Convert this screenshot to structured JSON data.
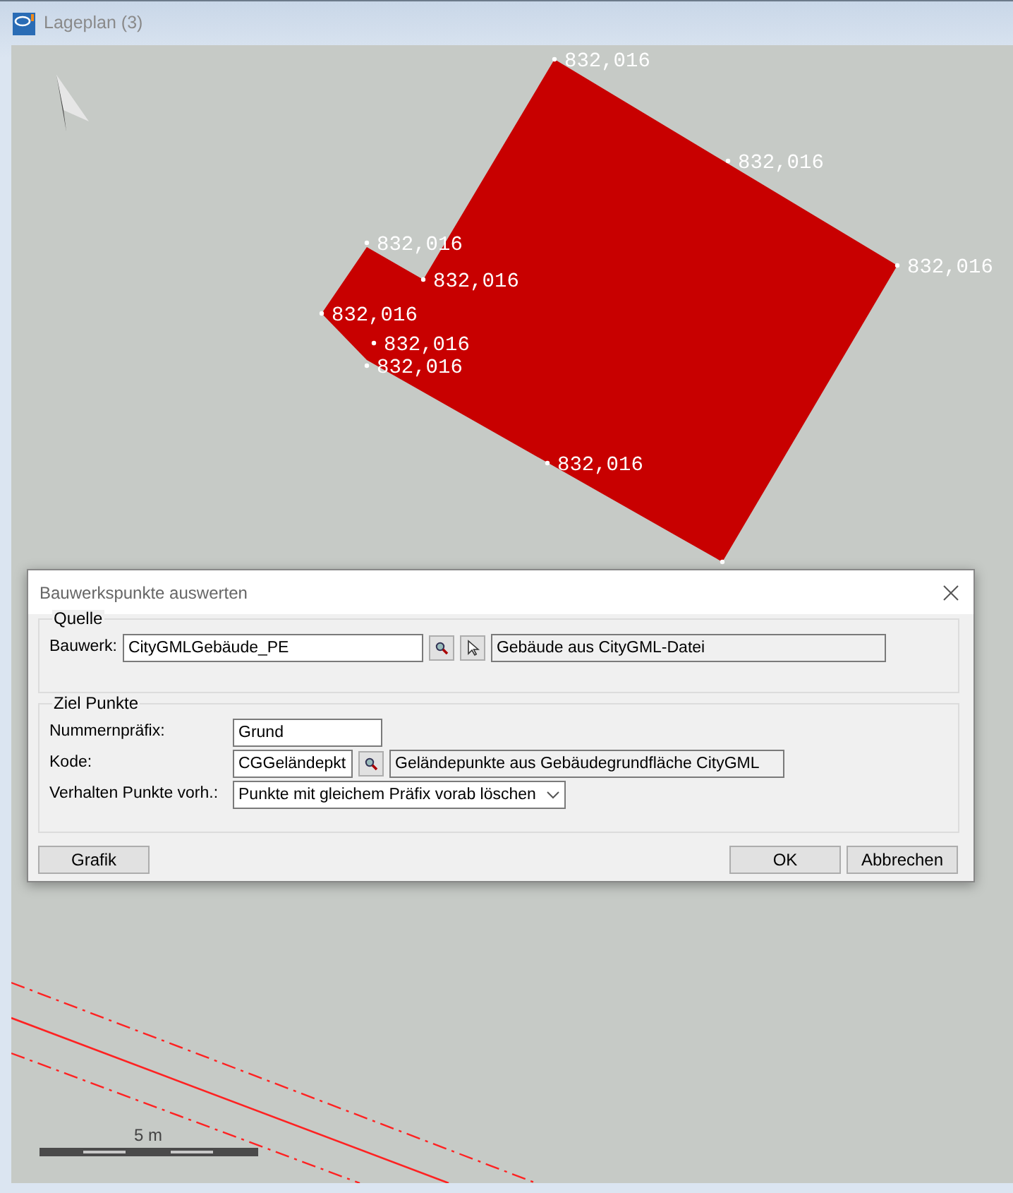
{
  "window": {
    "title": "Lageplan (3)"
  },
  "map": {
    "point_labels": [
      {
        "text": "832,016"
      },
      {
        "text": "832,016"
      },
      {
        "text": "832,016"
      },
      {
        "text": "832,016"
      },
      {
        "text": "832,016"
      },
      {
        "text": "832,016"
      },
      {
        "text": "832,016"
      },
      {
        "text": "832,016"
      },
      {
        "text": "832,016"
      }
    ],
    "scale_label": "5 m"
  },
  "dialog": {
    "title": "Bauwerkspunkte auswerten",
    "groups": [
      {
        "title": "Quelle",
        "rows": [
          {
            "kind": "lookup",
            "label": "Bauwerk:",
            "value": "CityGMLGebäude_PE",
            "buttons": [
              {
                "kind": "search"
              },
              {
                "kind": "pick"
              }
            ],
            "description": "Gebäude aus CityGML-Datei"
          }
        ]
      },
      {
        "title": "Ziel Punkte",
        "rows": [
          {
            "kind": "text",
            "label": "Nummernpräfix:",
            "value": "Grund"
          },
          {
            "kind": "lookup",
            "label": "Kode:",
            "value": "CGGeländepkt",
            "buttons": [
              {
                "kind": "search"
              }
            ],
            "description": "Geländepunkte aus Gebäudegrundfläche CityGML"
          },
          {
            "kind": "select",
            "label": "Verhalten Punkte vorh.:",
            "value": "Punkte mit gleichem Präfix vorab löschen"
          }
        ]
      }
    ],
    "left_buttons": [
      {
        "label": "Grafik"
      }
    ],
    "right_buttons": [
      {
        "label": "OK"
      },
      {
        "label": "Abbrechen"
      }
    ]
  }
}
